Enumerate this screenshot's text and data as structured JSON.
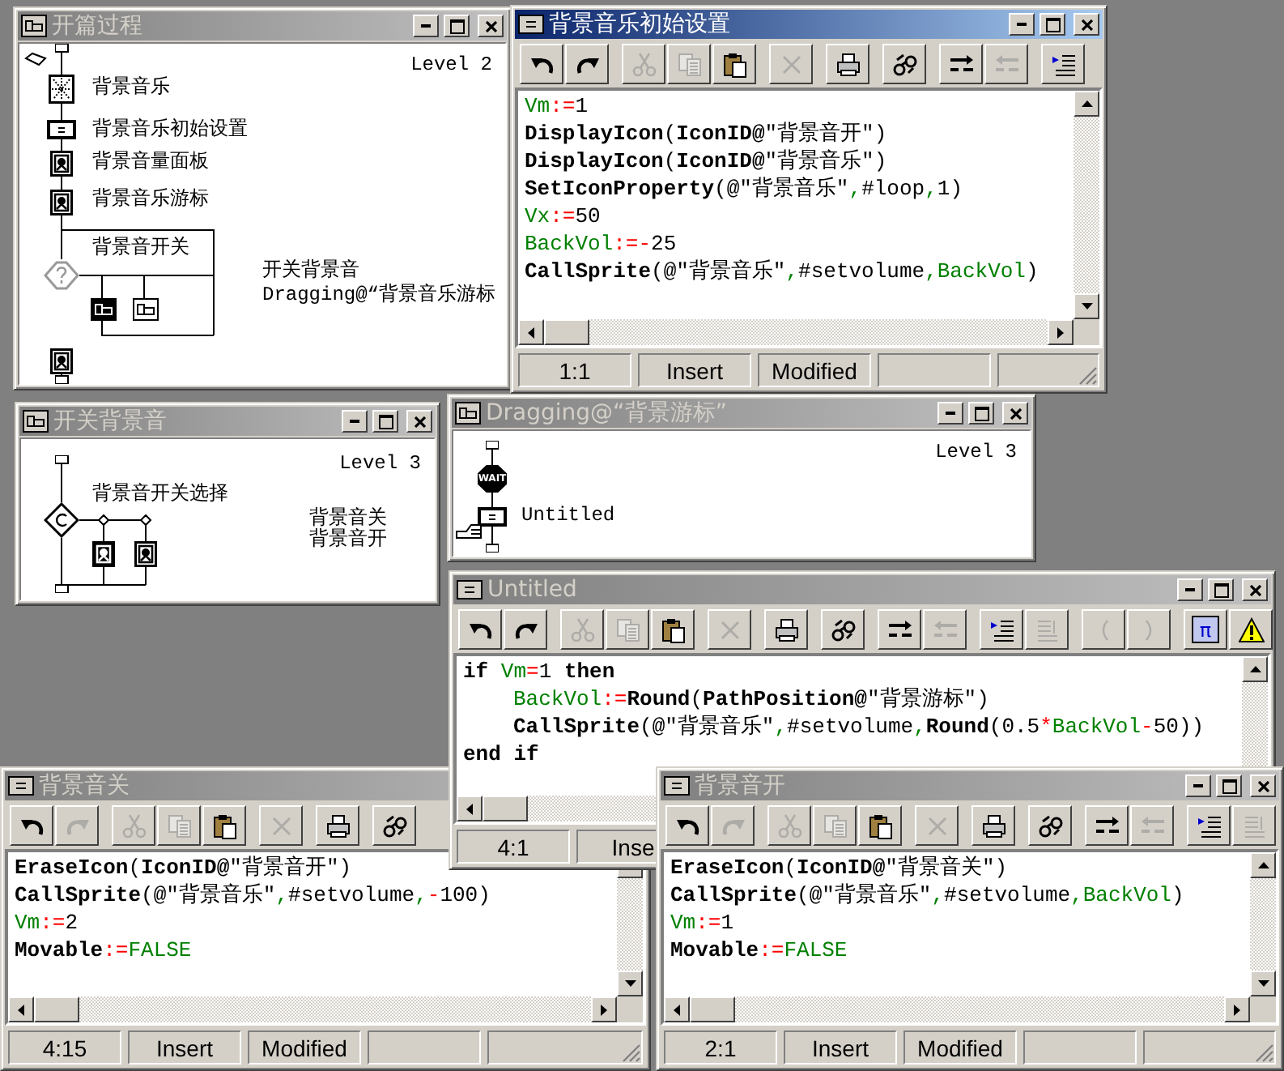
{
  "windows": [
    {
      "kind": "flow",
      "title": "开篇过程",
      "active": false,
      "level": "Level 2",
      "nodes": [
        {
          "kind": "start-flag"
        },
        {
          "kind": "sound",
          "label": "背景音乐"
        },
        {
          "kind": "calc",
          "label": "背景音乐初始设置"
        },
        {
          "kind": "display",
          "label": "背景音量面板"
        },
        {
          "kind": "display",
          "label": "背景音乐游标"
        },
        {
          "kind": "decision",
          "label": "背景音开关"
        },
        {
          "kind": "display"
        }
      ],
      "branches": [
        {
          "kind": "map",
          "selected": true,
          "label": "开关背景音"
        },
        {
          "kind": "map",
          "selected": false,
          "label": "Dragging@“背景音乐游标"
        }
      ]
    },
    {
      "kind": "calc",
      "title": "背景音乐初始设置",
      "active": true,
      "toolbar": [
        {
          "kind": "undo",
          "disabled": false
        },
        {
          "kind": "redo",
          "disabled": false
        },
        {
          "kind": "cut",
          "disabled": true
        },
        {
          "kind": "copy",
          "disabled": true
        },
        {
          "kind": "paste",
          "disabled": false
        },
        {
          "kind": "delete",
          "disabled": true
        },
        {
          "kind": "print",
          "disabled": false
        },
        {
          "kind": "find",
          "disabled": false
        },
        {
          "kind": "tab-right",
          "disabled": false
        },
        {
          "kind": "tab-left",
          "disabled": true
        },
        {
          "kind": "indent",
          "disabled": false
        }
      ],
      "code": [
        {
          "tokens": [
            {
              "kind": "variable",
              "text": "Vm"
            },
            {
              "kind": "operator",
              "text": ":="
            },
            {
              "kind": "text",
              "text": "1"
            }
          ]
        },
        {
          "tokens": [
            {
              "kind": "keyword",
              "text": "DisplayIcon"
            },
            {
              "kind": "text",
              "text": "("
            },
            {
              "kind": "keyword",
              "text": "IconID@"
            },
            {
              "kind": "text",
              "text": "\"背景音开\")"
            }
          ]
        },
        {
          "tokens": [
            {
              "kind": "keyword",
              "text": "DisplayIcon"
            },
            {
              "kind": "text",
              "text": "("
            },
            {
              "kind": "keyword",
              "text": "IconID@"
            },
            {
              "kind": "text",
              "text": "\"背景音乐\")"
            }
          ]
        },
        {
          "tokens": [
            {
              "kind": "keyword",
              "text": "SetIconProperty"
            },
            {
              "kind": "text",
              "text": "(@\"背景音乐\""
            },
            {
              "kind": "comma",
              "text": ","
            },
            {
              "kind": "text",
              "text": "#loop"
            },
            {
              "kind": "comma",
              "text": ","
            },
            {
              "kind": "text",
              "text": "1)"
            }
          ]
        },
        {
          "tokens": [
            {
              "kind": "variable",
              "text": "Vx"
            },
            {
              "kind": "operator",
              "text": ":="
            },
            {
              "kind": "text",
              "text": "50"
            }
          ]
        },
        {
          "tokens": [
            {
              "kind": "variable",
              "text": "BackVol"
            },
            {
              "kind": "operator",
              "text": ":=-"
            },
            {
              "kind": "text",
              "text": "25"
            }
          ]
        },
        {
          "tokens": [
            {
              "kind": "keyword",
              "text": "CallSprite"
            },
            {
              "kind": "text",
              "text": "(@\"背景音乐\""
            },
            {
              "kind": "comma",
              "text": ","
            },
            {
              "kind": "text",
              "text": "#setvolume"
            },
            {
              "kind": "comma",
              "text": ","
            },
            {
              "kind": "variable",
              "text": "BackVol"
            },
            {
              "kind": "text",
              "text": ")"
            }
          ]
        }
      ],
      "status": {
        "position": "1:1",
        "mode": "Insert",
        "state": "Modified"
      }
    },
    {
      "kind": "flow",
      "title": "开关背景音",
      "active": false,
      "level": "Level 3",
      "nodes": [
        {
          "kind": "decision-c",
          "label": "背景音开关选择"
        }
      ],
      "branches": [
        {
          "kind": "display",
          "selected": true,
          "label": "背景音关"
        },
        {
          "kind": "display",
          "selected": false,
          "label": "背景音开"
        }
      ]
    },
    {
      "kind": "flow",
      "title": "Dragging@“背景游标”",
      "active": false,
      "level": "Level 3",
      "nodes": [
        {
          "kind": "wait",
          "badge": "WAIT"
        },
        {
          "kind": "calc",
          "label": "Untitled"
        }
      ],
      "paste_pointer": true
    },
    {
      "kind": "calc",
      "title": "背景音关",
      "active": false,
      "toolbar": [
        {
          "kind": "undo",
          "disabled": false
        },
        {
          "kind": "redo",
          "disabled": true
        },
        {
          "kind": "cut",
          "disabled": true
        },
        {
          "kind": "copy",
          "disabled": true
        },
        {
          "kind": "paste",
          "disabled": false
        },
        {
          "kind": "delete",
          "disabled": true
        },
        {
          "kind": "print",
          "disabled": false
        },
        {
          "kind": "find",
          "disabled": false
        }
      ],
      "code": [
        {
          "tokens": [
            {
              "kind": "keyword",
              "text": "EraseIcon"
            },
            {
              "kind": "text",
              "text": "("
            },
            {
              "kind": "keyword",
              "text": "IconID@"
            },
            {
              "kind": "text",
              "text": "\"背景音开\")"
            }
          ]
        },
        {
          "tokens": [
            {
              "kind": "keyword",
              "text": "CallSprite"
            },
            {
              "kind": "text",
              "text": "(@\"背景音乐\""
            },
            {
              "kind": "comma",
              "text": ","
            },
            {
              "kind": "text",
              "text": "#setvolume"
            },
            {
              "kind": "comma",
              "text": ","
            },
            {
              "kind": "operator",
              "text": "-"
            },
            {
              "kind": "text",
              "text": "100)"
            }
          ]
        },
        {
          "tokens": [
            {
              "kind": "variable",
              "text": "Vm"
            },
            {
              "kind": "operator",
              "text": ":="
            },
            {
              "kind": "text",
              "text": "2"
            }
          ]
        },
        {
          "tokens": [
            {
              "kind": "keyword",
              "text": "Movable"
            },
            {
              "kind": "operator",
              "text": ":="
            },
            {
              "kind": "variable",
              "text": "FALSE"
            }
          ]
        }
      ],
      "status": {
        "position": "4:15",
        "mode": "Insert",
        "state": "Modified"
      }
    },
    {
      "kind": "calc",
      "title": "Untitled",
      "active": false,
      "toolbar": [
        {
          "kind": "undo",
          "disabled": false
        },
        {
          "kind": "redo",
          "disabled": false
        },
        {
          "kind": "cut",
          "disabled": true
        },
        {
          "kind": "copy",
          "disabled": true
        },
        {
          "kind": "paste",
          "disabled": false
        },
        {
          "kind": "delete",
          "disabled": true
        },
        {
          "kind": "print",
          "disabled": false
        },
        {
          "kind": "find",
          "disabled": false
        },
        {
          "kind": "tab-right",
          "disabled": false
        },
        {
          "kind": "tab-left",
          "disabled": true
        },
        {
          "kind": "indent",
          "disabled": false
        },
        {
          "kind": "outdent",
          "disabled": true
        },
        {
          "kind": "paren-open",
          "disabled": true
        },
        {
          "kind": "paren-close",
          "disabled": true
        },
        {
          "kind": "symbols",
          "disabled": false,
          "label": "π"
        },
        {
          "kind": "warning",
          "disabled": false
        }
      ],
      "code": [
        {
          "tokens": [
            {
              "kind": "keyword",
              "text": "if "
            },
            {
              "kind": "variable",
              "text": "Vm"
            },
            {
              "kind": "operator",
              "text": "="
            },
            {
              "kind": "text",
              "text": "1 "
            },
            {
              "kind": "keyword",
              "text": "then"
            }
          ]
        },
        {
          "indent": true,
          "tokens": [
            {
              "kind": "variable",
              "text": "BackVol"
            },
            {
              "kind": "operator",
              "text": ":="
            },
            {
              "kind": "keyword",
              "text": "Round"
            },
            {
              "kind": "text",
              "text": "("
            },
            {
              "kind": "keyword",
              "text": "PathPosition@"
            },
            {
              "kind": "text",
              "text": "\"背景游标\")"
            }
          ]
        },
        {
          "indent": true,
          "tokens": [
            {
              "kind": "keyword",
              "text": "CallSprite"
            },
            {
              "kind": "text",
              "text": "(@\"背景音乐\""
            },
            {
              "kind": "comma",
              "text": ","
            },
            {
              "kind": "text",
              "text": "#setvolume"
            },
            {
              "kind": "comma",
              "text": ","
            },
            {
              "kind": "keyword",
              "text": "Round"
            },
            {
              "kind": "text",
              "text": "(0.5"
            },
            {
              "kind": "operator",
              "text": "*"
            },
            {
              "kind": "variable",
              "text": "BackVol"
            },
            {
              "kind": "operator",
              "text": "-"
            },
            {
              "kind": "text",
              "text": "50))"
            }
          ]
        },
        {
          "tokens": [
            {
              "kind": "keyword",
              "text": "end if"
            }
          ]
        }
      ],
      "status": {
        "position": "4:1",
        "mode": "Inse"
      }
    },
    {
      "kind": "calc",
      "title": "背景音开",
      "active": false,
      "toolbar": [
        {
          "kind": "undo",
          "disabled": false
        },
        {
          "kind": "redo",
          "disabled": true
        },
        {
          "kind": "cut",
          "disabled": true
        },
        {
          "kind": "copy",
          "disabled": true
        },
        {
          "kind": "paste",
          "disabled": false
        },
        {
          "kind": "delete",
          "disabled": true
        },
        {
          "kind": "print",
          "disabled": false
        },
        {
          "kind": "find",
          "disabled": false
        },
        {
          "kind": "tab-right",
          "disabled": false
        },
        {
          "kind": "tab-left",
          "disabled": true
        },
        {
          "kind": "indent",
          "disabled": false
        },
        {
          "kind": "outdent",
          "disabled": true
        }
      ],
      "code": [
        {
          "tokens": [
            {
              "kind": "keyword",
              "text": "EraseIcon"
            },
            {
              "kind": "text",
              "text": "("
            },
            {
              "kind": "keyword",
              "text": "IconID@"
            },
            {
              "kind": "text",
              "text": "\"背景音关\")"
            }
          ]
        },
        {
          "tokens": [
            {
              "kind": "keyword",
              "text": "CallSprite"
            },
            {
              "kind": "text",
              "text": "(@\"背景音乐\""
            },
            {
              "kind": "comma",
              "text": ","
            },
            {
              "kind": "text",
              "text": "#setvolume"
            },
            {
              "kind": "comma",
              "text": ","
            },
            {
              "kind": "variable",
              "text": "BackVol"
            },
            {
              "kind": "text",
              "text": ")"
            }
          ]
        },
        {
          "tokens": [
            {
              "kind": "variable",
              "text": "Vm"
            },
            {
              "kind": "operator",
              "text": ":="
            },
            {
              "kind": "text",
              "text": "1"
            }
          ]
        },
        {
          "tokens": [
            {
              "kind": "keyword",
              "text": "Movable"
            },
            {
              "kind": "operator",
              "text": ":="
            },
            {
              "kind": "variable",
              "text": "FALSE"
            }
          ]
        }
      ],
      "status": {
        "position": "2:1",
        "mode": "Insert",
        "state": "Modified"
      }
    }
  ]
}
